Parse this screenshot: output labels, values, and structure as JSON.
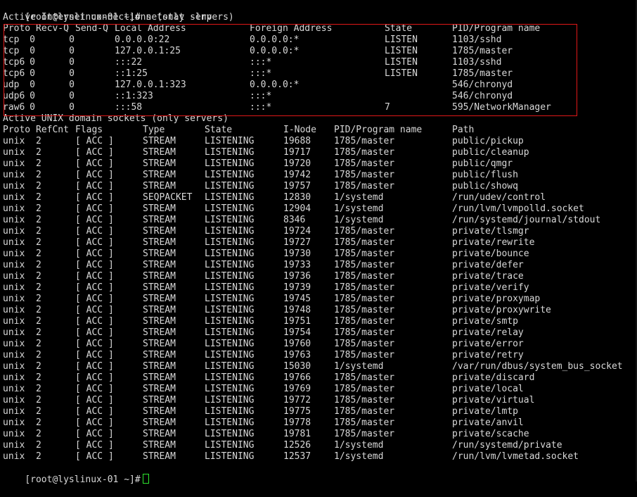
{
  "colors": {
    "background": "#000000",
    "text": "#d8d8d8",
    "highlight_border": "#e01818",
    "cursor": "#2ee82e"
  },
  "command": {
    "prompt": "[root@lyslinux-01 ~]#",
    "text": "netstat -lnp"
  },
  "inet": {
    "section_title": "Active Internet connections (only servers)",
    "headers": [
      "Proto",
      "Recv-Q",
      "Send-Q",
      "Local Address",
      "Foreign Address",
      "State",
      "PID/Program name"
    ],
    "rows": [
      [
        "tcp",
        "0",
        "0",
        "0.0.0.0:22",
        "0.0.0.0:*",
        "LISTEN",
        "1103/sshd"
      ],
      [
        "tcp",
        "0",
        "0",
        "127.0.0.1:25",
        "0.0.0.0:*",
        "LISTEN",
        "1785/master"
      ],
      [
        "tcp6",
        "0",
        "0",
        ":::22",
        ":::*",
        "LISTEN",
        "1103/sshd"
      ],
      [
        "tcp6",
        "0",
        "0",
        "::1:25",
        ":::*",
        "LISTEN",
        "1785/master"
      ],
      [
        "udp",
        "0",
        "0",
        "127.0.0.1:323",
        "0.0.0.0:*",
        "",
        "546/chronyd"
      ],
      [
        "udp6",
        "0",
        "0",
        "::1:323",
        ":::*",
        "",
        "546/chronyd"
      ],
      [
        "raw6",
        "0",
        "0",
        ":::58",
        ":::*",
        "7",
        "595/NetworkManager"
      ]
    ]
  },
  "unix": {
    "section_title": "Active UNIX domain sockets (only servers)",
    "headers": [
      "Proto",
      "RefCnt",
      "Flags",
      "Type",
      "State",
      "I-Node",
      "PID/Program name",
      "Path"
    ],
    "rows": [
      [
        "unix",
        "2",
        "[ ACC ]",
        "STREAM",
        "LISTENING",
        "19688",
        "1785/master",
        "public/pickup"
      ],
      [
        "unix",
        "2",
        "[ ACC ]",
        "STREAM",
        "LISTENING",
        "19717",
        "1785/master",
        "public/cleanup"
      ],
      [
        "unix",
        "2",
        "[ ACC ]",
        "STREAM",
        "LISTENING",
        "19720",
        "1785/master",
        "public/qmgr"
      ],
      [
        "unix",
        "2",
        "[ ACC ]",
        "STREAM",
        "LISTENING",
        "19742",
        "1785/master",
        "public/flush"
      ],
      [
        "unix",
        "2",
        "[ ACC ]",
        "STREAM",
        "LISTENING",
        "19757",
        "1785/master",
        "public/showq"
      ],
      [
        "unix",
        "2",
        "[ ACC ]",
        "SEQPACKET",
        "LISTENING",
        "12830",
        "1/systemd",
        "/run/udev/control"
      ],
      [
        "unix",
        "2",
        "[ ACC ]",
        "STREAM",
        "LISTENING",
        "12904",
        "1/systemd",
        "/run/lvm/lvmpolld.socket"
      ],
      [
        "unix",
        "2",
        "[ ACC ]",
        "STREAM",
        "LISTENING",
        "8346",
        "1/systemd",
        "/run/systemd/journal/stdout"
      ],
      [
        "unix",
        "2",
        "[ ACC ]",
        "STREAM",
        "LISTENING",
        "19724",
        "1785/master",
        "private/tlsmgr"
      ],
      [
        "unix",
        "2",
        "[ ACC ]",
        "STREAM",
        "LISTENING",
        "19727",
        "1785/master",
        "private/rewrite"
      ],
      [
        "unix",
        "2",
        "[ ACC ]",
        "STREAM",
        "LISTENING",
        "19730",
        "1785/master",
        "private/bounce"
      ],
      [
        "unix",
        "2",
        "[ ACC ]",
        "STREAM",
        "LISTENING",
        "19733",
        "1785/master",
        "private/defer"
      ],
      [
        "unix",
        "2",
        "[ ACC ]",
        "STREAM",
        "LISTENING",
        "19736",
        "1785/master",
        "private/trace"
      ],
      [
        "unix",
        "2",
        "[ ACC ]",
        "STREAM",
        "LISTENING",
        "19739",
        "1785/master",
        "private/verify"
      ],
      [
        "unix",
        "2",
        "[ ACC ]",
        "STREAM",
        "LISTENING",
        "19745",
        "1785/master",
        "private/proxymap"
      ],
      [
        "unix",
        "2",
        "[ ACC ]",
        "STREAM",
        "LISTENING",
        "19748",
        "1785/master",
        "private/proxywrite"
      ],
      [
        "unix",
        "2",
        "[ ACC ]",
        "STREAM",
        "LISTENING",
        "19751",
        "1785/master",
        "private/smtp"
      ],
      [
        "unix",
        "2",
        "[ ACC ]",
        "STREAM",
        "LISTENING",
        "19754",
        "1785/master",
        "private/relay"
      ],
      [
        "unix",
        "2",
        "[ ACC ]",
        "STREAM",
        "LISTENING",
        "19760",
        "1785/master",
        "private/error"
      ],
      [
        "unix",
        "2",
        "[ ACC ]",
        "STREAM",
        "LISTENING",
        "19763",
        "1785/master",
        "private/retry"
      ],
      [
        "unix",
        "2",
        "[ ACC ]",
        "STREAM",
        "LISTENING",
        "15030",
        "1/systemd",
        "/var/run/dbus/system_bus_socket"
      ],
      [
        "unix",
        "2",
        "[ ACC ]",
        "STREAM",
        "LISTENING",
        "19766",
        "1785/master",
        "private/discard"
      ],
      [
        "unix",
        "2",
        "[ ACC ]",
        "STREAM",
        "LISTENING",
        "19769",
        "1785/master",
        "private/local"
      ],
      [
        "unix",
        "2",
        "[ ACC ]",
        "STREAM",
        "LISTENING",
        "19772",
        "1785/master",
        "private/virtual"
      ],
      [
        "unix",
        "2",
        "[ ACC ]",
        "STREAM",
        "LISTENING",
        "19775",
        "1785/master",
        "private/lmtp"
      ],
      [
        "unix",
        "2",
        "[ ACC ]",
        "STREAM",
        "LISTENING",
        "19778",
        "1785/master",
        "private/anvil"
      ],
      [
        "unix",
        "2",
        "[ ACC ]",
        "STREAM",
        "LISTENING",
        "19781",
        "1785/master",
        "private/scache"
      ],
      [
        "unix",
        "2",
        "[ ACC ]",
        "STREAM",
        "LISTENING",
        "12526",
        "1/systemd",
        "/run/systemd/private"
      ],
      [
        "unix",
        "2",
        "[ ACC ]",
        "STREAM",
        "LISTENING",
        "12537",
        "1/systemd",
        "/run/lvm/lvmetad.socket"
      ]
    ]
  },
  "final_prompt": "[root@lyslinux-01 ~]#"
}
